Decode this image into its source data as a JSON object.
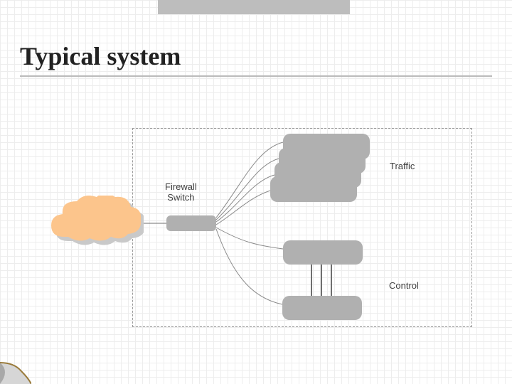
{
  "title": "Typical system",
  "labels": {
    "firewall": "Firewall\nSwitch",
    "traffic": "Traffic",
    "control": "Control"
  },
  "colors": {
    "node": "#b0b0b0",
    "cloud_fill": "#fcc58c",
    "cloud_shadow": "#c9c9c9",
    "line": "#8a8a8a"
  }
}
